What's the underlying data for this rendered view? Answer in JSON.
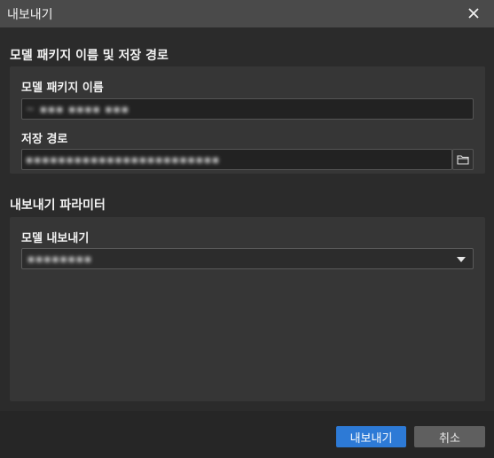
{
  "window": {
    "title": "내보내기"
  },
  "section_package": {
    "title": "모델 패키지 이름 및 저장 경로",
    "name_label": "모델 패키지 이름",
    "name_value": "~ ▪▪▪ ▪▪▪▪ ▪▪▪",
    "path_label": "저장 경로",
    "path_value": "▪▪▪▪▪▪▪▪▪▪▪▪▪▪▪▪▪▪▪▪▪▪▪▪"
  },
  "section_params": {
    "title": "내보내기 파라미터",
    "model_export_label": "모델 내보내기",
    "model_export_value": "▪▪▪▪▪▪▪▪"
  },
  "footer": {
    "export_label": "내보내기",
    "cancel_label": "취소"
  },
  "icons": {
    "close": "close-icon",
    "folder": "folder-icon",
    "dropdown": "chevron-down-icon"
  },
  "colors": {
    "accent": "#2d7ad6",
    "background": "#2b2b2b",
    "titlebar": "#4a4a4a",
    "panel": "#363636"
  }
}
